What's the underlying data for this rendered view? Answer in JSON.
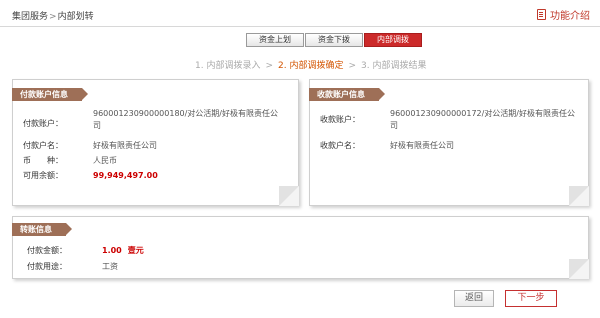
{
  "breadcrumb": {
    "section": "集团服务",
    "separator": ">",
    "page": "内部划转"
  },
  "help": {
    "label": "功能介绍",
    "icon": "book-icon"
  },
  "tabs": [
    {
      "label": "资金上划",
      "active": false
    },
    {
      "label": "资金下拨",
      "active": false
    },
    {
      "label": "内部调拨",
      "active": true
    }
  ],
  "steps": [
    {
      "label": "1. 内部调拨录入",
      "state": "done"
    },
    {
      "label": "2. 内部调拨确定",
      "state": "current"
    },
    {
      "label": "3. 内部调拨结果",
      "state": "pending"
    }
  ],
  "step_arrow": ">",
  "payer": {
    "title": "付款账户信息",
    "account_label": "付款账户：",
    "account_value": "96000123090000018​0/对公活期/好极有限责任公司",
    "name_label": "付款户名：",
    "name_value": "好极有限责任公司",
    "currency_label": "币　　种：",
    "currency_value": "人民币",
    "balance_label": "可用余额：",
    "balance_value": "99,949,497.00"
  },
  "payee": {
    "title": "收款账户信息",
    "account_label": "收款账户：",
    "account_value": "960001230900000172/对公活期/好极有限责任公司",
    "name_label": "收款户名：",
    "name_value": "好极有限责任公司"
  },
  "transfer": {
    "title": "转账信息",
    "amount_label": "付款金额：",
    "amount_value": "1.00",
    "amount_words": "壹元",
    "purpose_label": "付款用途：",
    "purpose_value": "工资"
  },
  "buttons": {
    "back": "返回",
    "next": "下一步"
  },
  "colors": {
    "accent": "#cc2a2a",
    "panel_title": "#9e6f57",
    "step_current": "#d35400",
    "amount": "#cc0000"
  }
}
